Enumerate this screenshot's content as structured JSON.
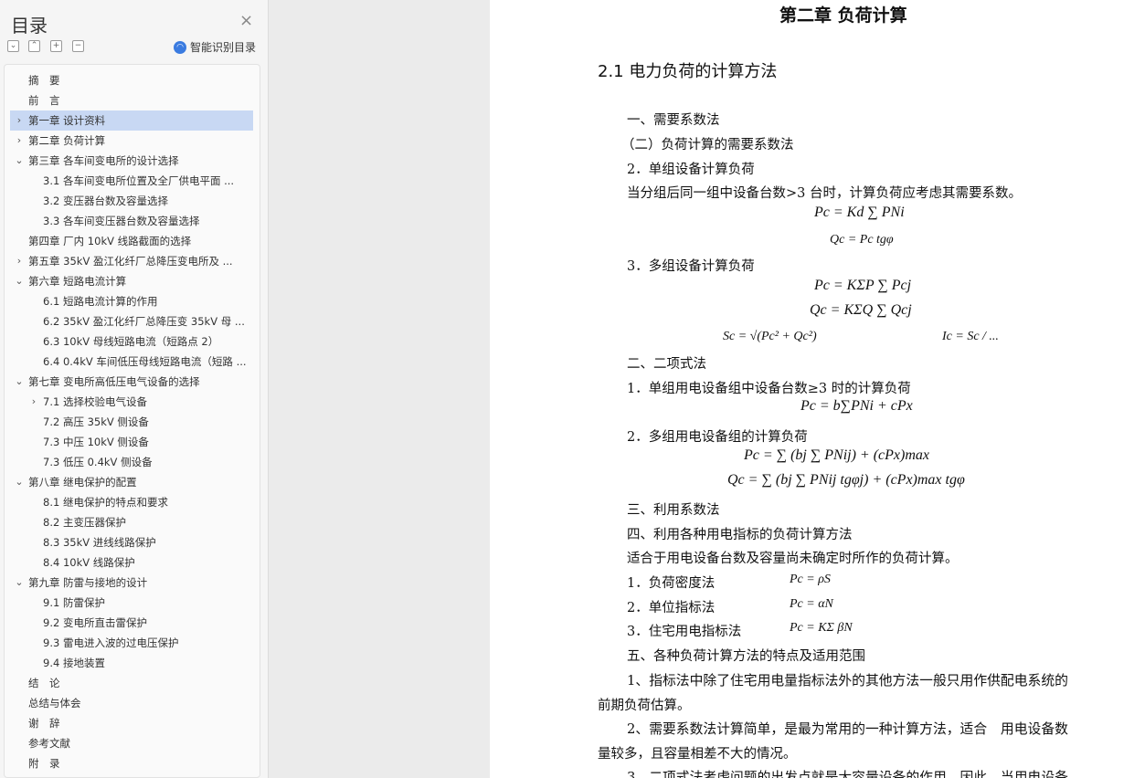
{
  "sidebar": {
    "title": "目录",
    "close_glyph": "×",
    "buttons": [
      {
        "name": "collapse-all-button",
        "glyph": "⌄"
      },
      {
        "name": "expand-all-button",
        "glyph": "⌃"
      },
      {
        "name": "add-heading-button",
        "glyph": "+"
      },
      {
        "name": "remove-heading-button",
        "glyph": "−"
      }
    ],
    "smart_label": "智能识别目录",
    "toc": [
      {
        "text": "摘　要",
        "level": 0,
        "chevron": ""
      },
      {
        "text": "前　言",
        "level": 0,
        "chevron": ""
      },
      {
        "text": "第一章  设计资料",
        "level": 0,
        "chevron": "›",
        "selected": true
      },
      {
        "text": "第二章  负荷计算",
        "level": 0,
        "chevron": "›"
      },
      {
        "text": "第三章  各车间变电所的设计选择",
        "level": 0,
        "chevron": "⌄"
      },
      {
        "text": "3.1  各车间变电所位置及全厂供电平面 ...",
        "level": 1,
        "chevron": ""
      },
      {
        "text": "3.2  变压器台数及容量选择",
        "level": 1,
        "chevron": ""
      },
      {
        "text": "3.3  各车间变压器台数及容量选择",
        "level": 1,
        "chevron": ""
      },
      {
        "text": "第四章  厂内 10kV 线路截面的选择",
        "level": 0,
        "chevron": ""
      },
      {
        "text": "第五章  35kV 盈江化纤厂总降压变电所及 ...",
        "level": 0,
        "chevron": "›"
      },
      {
        "text": "第六章  短路电流计算",
        "level": 0,
        "chevron": "⌄"
      },
      {
        "text": "6.1 短路电流计算的作用",
        "level": 1,
        "chevron": ""
      },
      {
        "text": "6.2 35kV 盈江化纤厂总降压变 35kV 母 ...",
        "level": 1,
        "chevron": ""
      },
      {
        "text": "6.3 10kV 母线短路电流（短路点 2）",
        "level": 1,
        "chevron": ""
      },
      {
        "text": "6.4 0.4kV 车间低压母线短路电流（短路 ...",
        "level": 1,
        "chevron": ""
      },
      {
        "text": "第七章  变电所高低压电气设备的选择",
        "level": 0,
        "chevron": "⌄"
      },
      {
        "text": "7.1 选择校验电气设备",
        "level": 1,
        "chevron": "›"
      },
      {
        "text": "7.2  高压 35kV 侧设备",
        "level": 1,
        "chevron": ""
      },
      {
        "text": "7.3  中压 10kV 侧设备",
        "level": 1,
        "chevron": ""
      },
      {
        "text": "7.3  低压 0.4kV 侧设备",
        "level": 1,
        "chevron": ""
      },
      {
        "text": "第八章  继电保护的配置",
        "level": 0,
        "chevron": "⌄"
      },
      {
        "text": "8.1 继电保护的特点和要求",
        "level": 1,
        "chevron": ""
      },
      {
        "text": "8.2 主变压器保护",
        "level": 1,
        "chevron": ""
      },
      {
        "text": "8.3 35kV 进线线路保护",
        "level": 1,
        "chevron": ""
      },
      {
        "text": "8.4 10kV 线路保护",
        "level": 1,
        "chevron": ""
      },
      {
        "text": "第九章  防雷与接地的设计",
        "level": 0,
        "chevron": "⌄"
      },
      {
        "text": "9.1  防雷保护",
        "level": 1,
        "chevron": ""
      },
      {
        "text": "9.2  变电所直击雷保护",
        "level": 1,
        "chevron": ""
      },
      {
        "text": "9.3  雷电进入波的过电压保护",
        "level": 1,
        "chevron": ""
      },
      {
        "text": "9.4  接地装置",
        "level": 1,
        "chevron": ""
      },
      {
        "text": "结　论",
        "level": 0,
        "chevron": ""
      },
      {
        "text": "总结与体会",
        "level": 0,
        "chevron": ""
      },
      {
        "text": "谢　辞",
        "level": 0,
        "chevron": ""
      },
      {
        "text": "参考文献",
        "level": 0,
        "chevron": ""
      },
      {
        "text": "附　录",
        "level": 0,
        "chevron": ""
      }
    ]
  },
  "document": {
    "chapter_title": "第二章  负荷计算",
    "section_title": "2.1 电力负荷的计算方法",
    "p1": "一、需要系数法",
    "p2": "（二）负荷计算的需要系数法",
    "p3": "2．单组设备计算负荷",
    "p4": "当分组后同一组中设备台数>3 台时，计算负荷应考虑其需要系数。",
    "f1": "Pc = Kd ∑ PNi",
    "f2": "Qc = Pc tgφ",
    "p5": "3．多组设备计算负荷",
    "f3": "Pc = KΣP ∑ Pcj",
    "f4": "Qc = KΣQ ∑ Qcj",
    "f5": "Sc = √(Pc² + Qc²)",
    "f6": "Ic = Sc / ...",
    "p6": "二、二项式法",
    "p7": "1．单组用电设备组中设备台数≥3 时的计算负荷",
    "f7": "Pc = b∑PNi + cPx",
    "p8": "2．多组用电设备组的计算负荷",
    "f8": "Pc = ∑ (bj ∑ PNij) + (cPx)max",
    "f9": "Qc = ∑ (bj ∑ PNij tgφj) + (cPx)max tgφ",
    "p9": "三、利用系数法",
    "p10": "四、利用各种用电指标的负荷计算方法",
    "p11": "适合于用电设备台数及容量尚未确定时所作的负荷计算。",
    "p12": "1．负荷密度法",
    "f10": "Pc = ρS",
    "p13": "2．单位指标法",
    "f11": "Pc = αN",
    "p14": "3．住宅用电指标法",
    "f12": "Pc = KΣ βN",
    "p15": "五、各种负荷计算方法的特点及适用范围",
    "p16": "1、指标法中除了住宅用电量指标法外的其他方法一般只用作供配电系统的",
    "p17": "前期负荷估算。",
    "p18": "2、需要系数法计算简单，是最为常用的一种计算方法，适合　用电设备数",
    "p19": "量较多，且容量相差不大的情况。",
    "p20": "3、二项式法考虑问题的出发点就是大容量设备的作用，因此，当用电设备"
  }
}
